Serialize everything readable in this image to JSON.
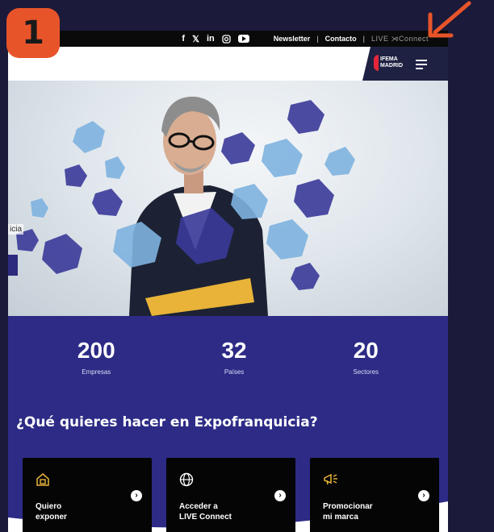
{
  "step_badge": "1",
  "topbar": {
    "social": [
      "f",
      "𝕏",
      "in"
    ],
    "links": [
      "Newsletter",
      "Contacto"
    ],
    "separator": "|",
    "live_connect": "LIVE ⋊Connect"
  },
  "header": {
    "logo_lines": [
      "IFEMA",
      "MADRID"
    ],
    "menu_icon": "hamburger-icon"
  },
  "hero": {
    "partial_text": "icia"
  },
  "stats": [
    {
      "value": "200",
      "label": "Empresas"
    },
    {
      "value": "32",
      "label": "Países"
    },
    {
      "value": "20",
      "label": "Sectores"
    }
  ],
  "question": "¿Qué quieres hacer en Expofranquicia?",
  "cards": [
    {
      "line1": "Quiero",
      "line2": "exponer",
      "icon": "building-icon"
    },
    {
      "line1": "Acceder a",
      "line2": "LIVE Connect",
      "icon": "globe-icon"
    },
    {
      "line1": "Promocionar",
      "line2": "mi marca",
      "icon": "megaphone-icon"
    }
  ],
  "colors": {
    "accent_orange": "#e8542a",
    "brand_purple": "#2d2b86",
    "ifema_red": "#e5263a"
  }
}
